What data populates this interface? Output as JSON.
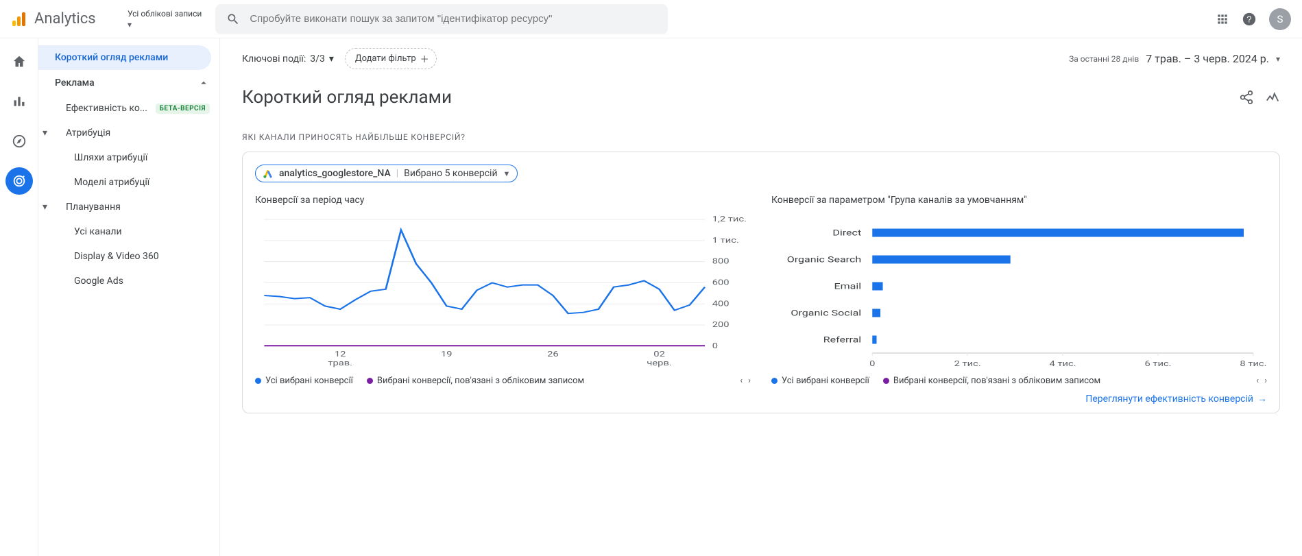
{
  "brand": "Analytics",
  "header": {
    "account_label": "Усі облікові записи",
    "search_placeholder": "Спробуйте виконати пошук за запитом \"ідентифікатор ресурсу\"",
    "avatar_letter": "S"
  },
  "sidebar": {
    "top": "Короткий огляд реклами",
    "ads_section": "Реклама",
    "eff_label": "Ефективність ко...",
    "beta": "БЕТА-ВЕРСІЯ",
    "attribution_section": "Атрибуція",
    "attr_paths": "Шляхи атрибуції",
    "attr_models": "Моделі атрибуції",
    "planning_section": "Планування",
    "all_channels": "Усі канали",
    "dv360": "Display & Video 360",
    "gads": "Google Ads"
  },
  "toolbar": {
    "key_events_prefix": "Ключові події:",
    "key_events_value": "3/3",
    "add_filter": "Додати фільтр",
    "date_prefix": "За останні 28 днів",
    "date_range": "7 трав. – 3 черв. 2024 р."
  },
  "page": {
    "title": "Короткий огляд реклами",
    "section_q1": "Які канали приносять найбільше конверсій?"
  },
  "card": {
    "property": "analytics_googlestore_NA",
    "conversions_selected": "Вибрано 5 конверсій",
    "leg_all": "Усі вибрані конверсії",
    "leg_acc": "Вибрані конверсії, пов'язані з обліковим записом",
    "footer_link": "Переглянути ефективність конверсій"
  },
  "chart_data": [
    {
      "type": "line",
      "title": "Конверсії за період часу",
      "ylabel": "",
      "ylim": [
        0,
        1200
      ],
      "yticks_text": [
        "0",
        "200",
        "400",
        "600",
        "800",
        "1 тис.",
        "1,2 тис."
      ],
      "x_ticks": [
        {
          "top": "12",
          "bottom": "трав."
        },
        {
          "top": "19",
          "bottom": " "
        },
        {
          "top": "26",
          "bottom": " "
        },
        {
          "top": "02",
          "bottom": "черв."
        }
      ],
      "series": [
        {
          "name": "Усі вибрані конверсії",
          "color": "#1a73e8",
          "values": [
            480,
            470,
            450,
            460,
            380,
            350,
            440,
            520,
            540,
            1100,
            780,
            600,
            380,
            350,
            530,
            600,
            560,
            580,
            580,
            480,
            310,
            320,
            350,
            560,
            580,
            620,
            540,
            340,
            390,
            560
          ]
        },
        {
          "name": "Вибрані конверсії, пов'язані з обліковим записом",
          "color": "#7b1fa2",
          "values": [
            5,
            5,
            5,
            5,
            5,
            5,
            5,
            5,
            5,
            5,
            5,
            5,
            5,
            5,
            5,
            5,
            5,
            5,
            5,
            5,
            5,
            5,
            5,
            5,
            5,
            5,
            5,
            5,
            5,
            5
          ]
        }
      ]
    },
    {
      "type": "bar",
      "title": "Конверсії за параметром \"Група каналів за умовчанням\"",
      "orientation": "horizontal",
      "xlim": [
        0,
        8000
      ],
      "xticks": [
        0,
        2000,
        4000,
        6000,
        8000
      ],
      "xticks_text": [
        "0",
        "2 тис.",
        "4 тис.",
        "6 тис.",
        "8 тис."
      ],
      "categories": [
        "Direct",
        "Organic Search",
        "Email",
        "Organic Social",
        "Referral"
      ],
      "series": [
        {
          "name": "Усі вибрані конверсії",
          "color": "#1a73e8",
          "values": [
            7800,
            2900,
            220,
            170,
            90
          ]
        },
        {
          "name": "Вибрані конверсії, пов'язані з обліковим записом",
          "color": "#7b1fa2",
          "values": [
            0,
            0,
            0,
            0,
            0
          ]
        }
      ]
    }
  ]
}
